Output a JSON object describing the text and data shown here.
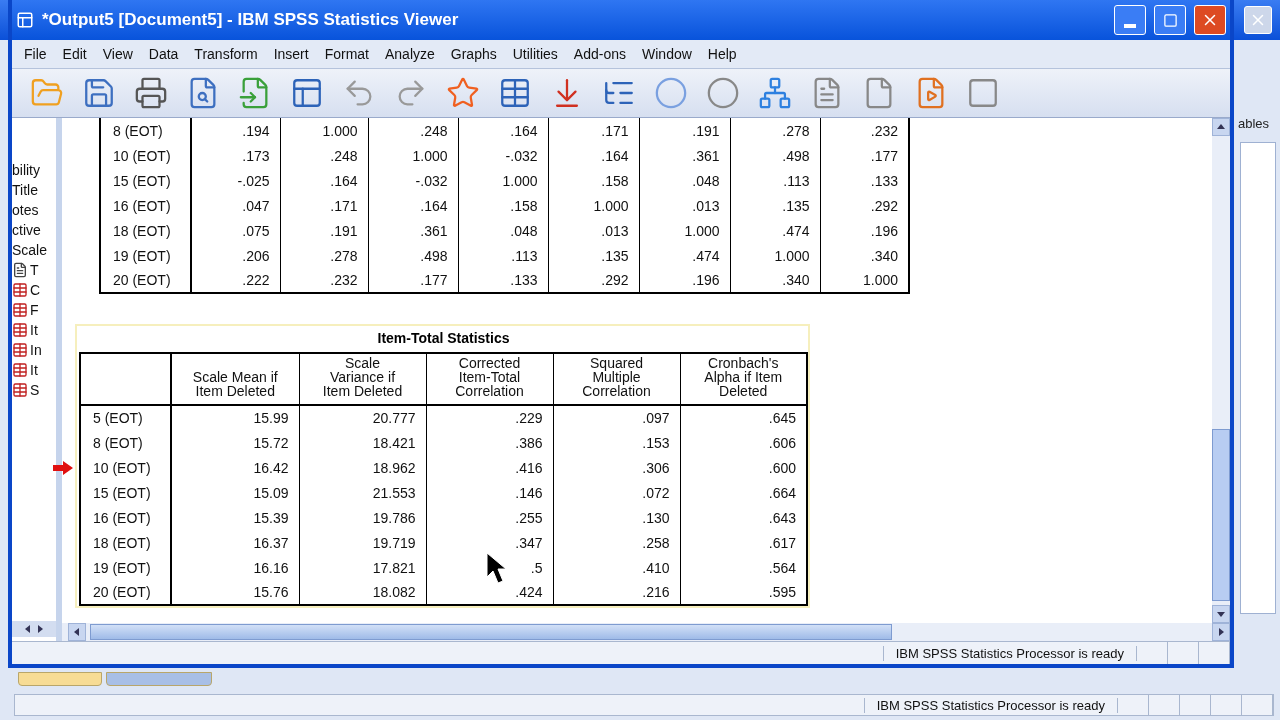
{
  "window": {
    "title": "*Output5 [Document5] - IBM SPSS Statistics Viewer"
  },
  "menu": [
    {
      "label": "File"
    },
    {
      "label": "Edit"
    },
    {
      "label": "View"
    },
    {
      "label": "Data"
    },
    {
      "label": "Transform"
    },
    {
      "label": "Insert"
    },
    {
      "label": "Format"
    },
    {
      "label": "Analyze"
    },
    {
      "label": "Graphs"
    },
    {
      "label": "Utilities"
    },
    {
      "label": "Add-ons"
    },
    {
      "label": "Window"
    },
    {
      "label": "Help"
    }
  ],
  "outline": [
    {
      "label": "bility",
      "kind": "text"
    },
    {
      "label": "Title",
      "kind": "text"
    },
    {
      "label": "otes",
      "kind": "text"
    },
    {
      "label": "ctive",
      "kind": "text"
    },
    {
      "label": "Scale",
      "kind": "text"
    },
    {
      "label": "T",
      "kind": "note"
    },
    {
      "label": "C",
      "kind": "table"
    },
    {
      "label": "F",
      "kind": "table"
    },
    {
      "label": "It",
      "kind": "table"
    },
    {
      "label": "In",
      "kind": "table"
    },
    {
      "label": "It",
      "kind": "table"
    },
    {
      "label": "S",
      "kind": "table"
    }
  ],
  "correlation_table": {
    "rows": [
      {
        "label": "8 (EOT)",
        "values": [
          ".194",
          "1.000",
          ".248",
          ".164",
          ".171",
          ".191",
          ".278",
          ".232"
        ]
      },
      {
        "label": "10 (EOT)",
        "values": [
          ".173",
          ".248",
          "1.000",
          "-.032",
          ".164",
          ".361",
          ".498",
          ".177"
        ]
      },
      {
        "label": "15 (EOT)",
        "values": [
          "-.025",
          ".164",
          "-.032",
          "1.000",
          ".158",
          ".048",
          ".113",
          ".133"
        ]
      },
      {
        "label": "16 (EOT)",
        "values": [
          ".047",
          ".171",
          ".164",
          ".158",
          "1.000",
          ".013",
          ".135",
          ".292"
        ]
      },
      {
        "label": "18 (EOT)",
        "values": [
          ".075",
          ".191",
          ".361",
          ".048",
          ".013",
          "1.000",
          ".474",
          ".196"
        ]
      },
      {
        "label": "19 (EOT)",
        "values": [
          ".206",
          ".278",
          ".498",
          ".113",
          ".135",
          ".474",
          "1.000",
          ".340"
        ]
      },
      {
        "label": "20 (EOT)",
        "values": [
          ".222",
          ".232",
          ".177",
          ".133",
          ".292",
          ".196",
          ".340",
          "1.000"
        ]
      }
    ]
  },
  "item_total_table": {
    "title": "Item-Total Statistics",
    "columns": [
      "Scale Mean if\nItem Deleted",
      "Scale\nVariance if\nItem Deleted",
      "Corrected\nItem-Total\nCorrelation",
      "Squared\nMultiple\nCorrelation",
      "Cronbach's\nAlpha if Item\nDeleted"
    ],
    "rows": [
      {
        "label": "5 (EOT)",
        "current": false,
        "values": [
          "15.99",
          "20.777",
          ".229",
          ".097",
          ".645"
        ]
      },
      {
        "label": "8 (EOT)",
        "current": false,
        "values": [
          "15.72",
          "18.421",
          ".386",
          ".153",
          ".606"
        ]
      },
      {
        "label": "10 (EOT)",
        "current": true,
        "values": [
          "16.42",
          "18.962",
          ".416",
          ".306",
          ".600"
        ]
      },
      {
        "label": "15 (EOT)",
        "current": false,
        "values": [
          "15.09",
          "21.553",
          ".146",
          ".072",
          ".664"
        ]
      },
      {
        "label": "16 (EOT)",
        "current": false,
        "values": [
          "15.39",
          "19.786",
          ".255",
          ".130",
          ".643"
        ]
      },
      {
        "label": "18 (EOT)",
        "current": false,
        "values": [
          "16.37",
          "19.719",
          ".347",
          ".258",
          ".617"
        ]
      },
      {
        "label": "19 (EOT)",
        "current": false,
        "values": [
          "16.16",
          "17.821",
          ".5",
          ".410",
          ".564"
        ]
      },
      {
        "label": "20 (EOT)",
        "current": false,
        "values": [
          "15.76",
          "18.082",
          ".424",
          ".216",
          ".595"
        ]
      }
    ]
  },
  "status_bar": {
    "text": "IBM SPSS Statistics Processor is ready"
  },
  "background_window": {
    "tab": "ables",
    "status_text": "IBM SPSS Statistics Processor is ready"
  }
}
